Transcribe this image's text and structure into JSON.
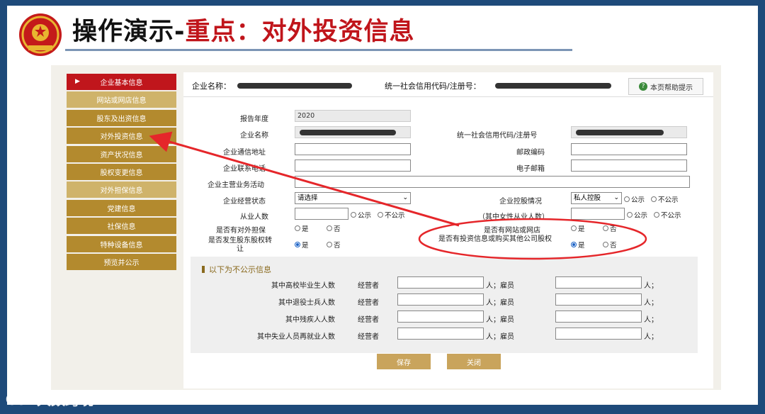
{
  "slide": {
    "title_part1": "操作演示-",
    "title_part2": "重点：对外投资信息"
  },
  "sidebar": {
    "items": [
      {
        "label": "企业基本信息",
        "state": "active"
      },
      {
        "label": "网站或网店信息",
        "state": "dim"
      },
      {
        "label": "股东及出资信息",
        "state": "normal"
      },
      {
        "label": "对外投资信息",
        "state": "normal"
      },
      {
        "label": "资产状况信息",
        "state": "normal"
      },
      {
        "label": "股权变更信息",
        "state": "normal"
      },
      {
        "label": "对外担保信息",
        "state": "dim"
      },
      {
        "label": "党建信息",
        "state": "normal"
      },
      {
        "label": "社保信息",
        "state": "normal"
      },
      {
        "label": "特种设备信息",
        "state": "normal"
      },
      {
        "label": "预览并公示",
        "state": "normal"
      }
    ]
  },
  "topbar": {
    "company_label": "企业名称：",
    "credit_label": "统一社会信用代码/注册号：",
    "help_label": "本页帮助提示"
  },
  "form": {
    "report_year_label": "报告年度",
    "report_year_value": "2020",
    "company_name_label": "企业名称",
    "credit_code_label": "统一社会信用代码/注册号",
    "address_label": "企业通信地址",
    "postcode_label": "邮政编码",
    "phone_label": "企业联系电话",
    "email_label": "电子邮箱",
    "business_label": "企业主营业务活动",
    "status_label": "企业经营状态",
    "status_value": "请选择",
    "holding_label": "企业控股情况",
    "holding_value": "私人控股",
    "public_label": "公示",
    "not_public_label": "不公示",
    "employees_label": "从业人数",
    "female_label": "（其中女性从业人数）",
    "guarantee_label": "是否有对外担保",
    "website_label": "是否有网站或网店",
    "equity_transfer_label": "是否发生股东股权转让",
    "invest_label": "是否有投资信息或购买其他公司股权",
    "yes_label": "是",
    "no_label": "否"
  },
  "private": {
    "title": "以下为不公示信息",
    "rows": [
      {
        "label": "其中高校毕业生人数"
      },
      {
        "label": "其中退役士兵人数"
      },
      {
        "label": "其中残疾人人数"
      },
      {
        "label": "其中失业人员再就业人数"
      }
    ],
    "operator_label": "经营者",
    "employee_label": "人；雇员",
    "end_label": "人；"
  },
  "buttons": {
    "save": "保存",
    "close": "关闭"
  },
  "watermark": "大数跨境",
  "colors": {
    "accent_red": "#c0161c",
    "sidebar_gold": "#b38a2e",
    "annotation_red": "#e5262a"
  }
}
